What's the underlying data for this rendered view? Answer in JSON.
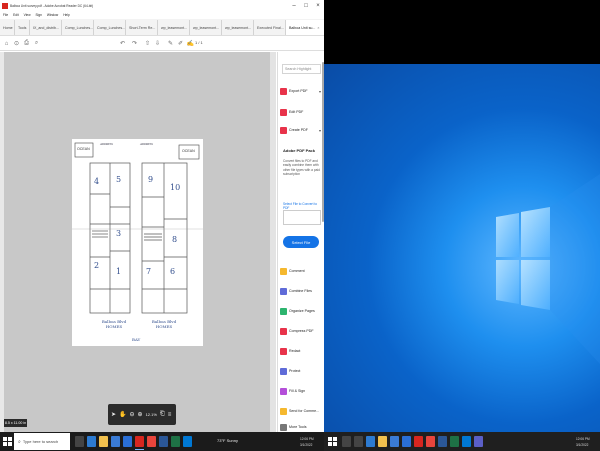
{
  "acrobat": {
    "window_title": "Balboa Unit survey.pdf - Adobe Acrobat Reader DC (64-bit)",
    "menu": [
      "File",
      "Edit",
      "View",
      "Sign",
      "Window",
      "Help"
    ],
    "tabs": [
      {
        "label": "Home",
        "type": "home"
      },
      {
        "label": "Tools",
        "type": "tools"
      },
      {
        "label": "IX_and_distrib...",
        "type": "doc"
      },
      {
        "label": "Comp_Lunches...",
        "type": "doc"
      },
      {
        "label": "Comp_Lunches...",
        "type": "doc"
      },
      {
        "label": "Short-Term Re...",
        "type": "doc"
      },
      {
        "label": "wp_leasemont...",
        "type": "doc"
      },
      {
        "label": "wp_leasemont...",
        "type": "doc"
      },
      {
        "label": "wp_leasemont...",
        "type": "doc"
      },
      {
        "label": "Executed Final...",
        "type": "doc"
      },
      {
        "label": "Balboa Unit su...",
        "type": "active"
      }
    ],
    "toolbar": {
      "page_indicator": "1 / 1"
    },
    "document": {
      "labels": {
        "ocean_left": "OCEAN",
        "ocean_right": "OCEAN",
        "top_note_left": "ADDRESS",
        "top_note_right": "ADDRESS",
        "left_building": "Balboa Blvd HOMES",
        "right_building": "Balboa Blvd HOMES",
        "bay": "BAY",
        "units": [
          "4",
          "5",
          "3",
          "2",
          "1",
          "9",
          "10",
          "6",
          "8",
          "7"
        ]
      }
    },
    "float_toolbar": {
      "zoom": "12.1%"
    },
    "size_tooltip": "8.5 x 11.00 in",
    "right_pane": {
      "search_placeholder": "Search Highlight",
      "tools_top": [
        {
          "label": "Export PDF",
          "color": "#e8334a",
          "chevron": true
        },
        {
          "label": "Edit PDF",
          "color": "#e8334a",
          "chevron": false
        },
        {
          "label": "Create PDF",
          "color": "#e8334a",
          "chevron": true
        }
      ],
      "pack_title": "Adobe PDF Pack",
      "pack_description": "Convert files to PDF and easily combine them with other file types with a paid subscription",
      "select_file": "Select File",
      "convert_link": "Select File to Convert to PDF",
      "tools_bottom": [
        {
          "label": "Comment",
          "color": "#f5b82e"
        },
        {
          "label": "Combine Files",
          "color": "#5f6bd8"
        },
        {
          "label": "Organize Pages",
          "color": "#2cb46e"
        },
        {
          "label": "Compress PDF",
          "color": "#e8334a"
        },
        {
          "label": "Redact",
          "color": "#e8334a"
        },
        {
          "label": "Protect",
          "color": "#5f6bd8"
        },
        {
          "label": "Fill & Sign",
          "color": "#b44fd9"
        },
        {
          "label": "Send for Comme...",
          "color": "#f5b82e"
        },
        {
          "label": "More Tools",
          "color": "#777777"
        }
      ]
    }
  },
  "taskbar_left": {
    "search_placeholder": "Type here to search",
    "weather": "73°F Sunny",
    "time": "12:06 PM",
    "date": "3/1/2022",
    "icons": [
      "task-view-icon",
      "edge-icon",
      "file-explorer-icon",
      "store-icon",
      "mail-icon",
      "acrobat-icon",
      "chrome-icon",
      "word-icon",
      "excel-icon",
      "outlook-icon",
      "teams-icon"
    ]
  },
  "taskbar_right": {
    "time": "12:06 PM",
    "date": "3/1/2022",
    "icons": [
      "search-icon",
      "task-view-icon",
      "edge-icon",
      "file-explorer-icon",
      "store-icon",
      "mail-icon",
      "acrobat-icon",
      "chrome-icon",
      "word-icon",
      "excel-icon",
      "outlook-icon",
      "teams-icon",
      "settings-icon"
    ]
  },
  "colors": {
    "accent": "#1473e6",
    "acrobat_red": "#d7261f",
    "wallpaper": "#0a63c9"
  }
}
